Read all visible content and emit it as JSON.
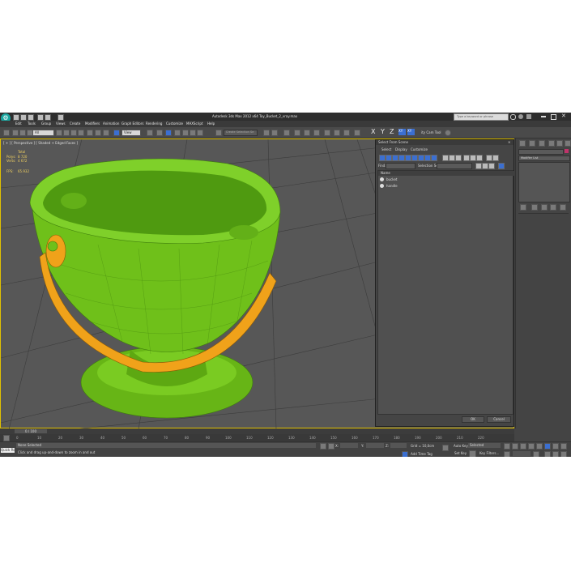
{
  "window": {
    "title": "Autodesk 3ds Max  2012 x64     Toy_Bucket_2_vray.max",
    "search_placeholder": "Type a keyword or phrase"
  },
  "menu": {
    "items": [
      "Edit",
      "Tools",
      "Group",
      "Views",
      "Create",
      "Modifiers",
      "Animation",
      "Graph Editors",
      "Rendering",
      "Customize",
      "MAXScript",
      "Help"
    ]
  },
  "toolbar": {
    "filter_value": "All",
    "view_value": "View",
    "selection_set_value": "Create Selection Se",
    "axis_labels": [
      "X",
      "Y",
      "Z",
      "XY",
      "XY"
    ],
    "tool_label": "ity Cam Tool"
  },
  "viewport": {
    "label": "[ + ] [ Perspective ] [ Shaded + Edged Faces ]",
    "stats_total": "Total",
    "polys_label": "Polys:",
    "polys_value": "8 720",
    "verts_label": "Verts:",
    "verts_value": "4 672",
    "fps_label": "FPS:",
    "fps_value": "65.932"
  },
  "dialog": {
    "title": "Select From Scene",
    "menu_items": [
      "Select",
      "Display",
      "Customize"
    ],
    "find_label": "Find:",
    "selection_set_label": "Selection Set:",
    "column_header": "Name",
    "items": [
      "bucket",
      "handle"
    ],
    "ok_label": "OK",
    "cancel_label": "Cancel"
  },
  "command_panel": {
    "modifier_list_label": "Modifier List"
  },
  "timeline": {
    "frame_counter": "0 / 100",
    "ticks": [
      "0",
      "10",
      "20",
      "30",
      "40",
      "50",
      "60",
      "70",
      "80",
      "90",
      "100",
      "110",
      "120",
      "130",
      "140",
      "150",
      "160",
      "170",
      "180",
      "190",
      "200",
      "210",
      "220"
    ]
  },
  "status": {
    "maxscript_button": "Quick Rc",
    "selection_status": "None Selected",
    "prompt": "Click and drag up-and-down to zoom in and out",
    "x_label": "X:",
    "y_label": "Y:",
    "z_label": "Z:",
    "grid_label": "Grid = 10,0cm",
    "auto_key_label": "Auto Key",
    "auto_key_value": "Selected",
    "set_key_label": "Set Key",
    "key_filters_label": "Key Filters...",
    "add_time_tag_label": "Add Time Tag"
  },
  "colors": {
    "bucket": "#6fc01a",
    "handle": "#f0a21a",
    "active_border": "#e0c000",
    "accent_blue": "#3b6fd1"
  }
}
